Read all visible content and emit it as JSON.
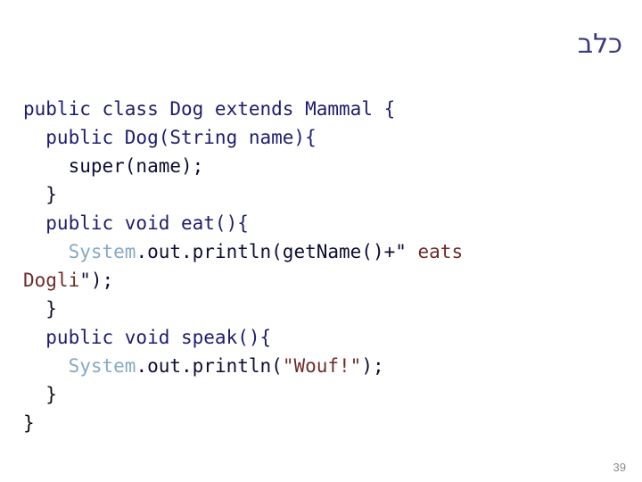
{
  "slide": {
    "title": "כלב",
    "title_color": "#3a3a80",
    "background_color": "#ffffff",
    "page_number": "39"
  },
  "colors": {
    "code_default": "#1c1c6e",
    "code_dark": "#0d0d33",
    "code_black": "#101010",
    "class_name": "#86a9c4",
    "string_literal": "#6d2b2b",
    "page_number": "#8a8a8a"
  },
  "code": {
    "language": "java",
    "full_text": "public class Dog extends Mammal {\n  public Dog(String name){\n    super(name);\n  }\n  public void eat(){\n    System.out.println(getName()+\" eats Dogli\");\n  }\n  public void speak(){\n    System.out.println(\"Wouf!\");\n  }\n}",
    "lines": [
      {
        "id": "line-1",
        "segments": [
          {
            "text": "public class Dog extends Mammal {",
            "style": "tok-default"
          }
        ]
      },
      {
        "id": "line-2",
        "segments": [
          {
            "text": "  public Dog(String name){",
            "style": "tok-default"
          }
        ]
      },
      {
        "id": "line-3",
        "segments": [
          {
            "text": "    super(name);",
            "style": "tok-dark"
          }
        ]
      },
      {
        "id": "line-4",
        "segments": [
          {
            "text": "  }",
            "style": "tok-dark"
          }
        ]
      },
      {
        "id": "line-5",
        "segments": [
          {
            "text": "  public void eat(){",
            "style": "tok-default"
          }
        ]
      },
      {
        "id": "line-6",
        "segments": [
          {
            "text": "    ",
            "style": "tok-default"
          },
          {
            "text": "System",
            "style": "tok-class"
          },
          {
            "text": ".out.println(getName()+\"",
            "style": "tok-dark"
          },
          {
            "text": " eats",
            "style": "tok-string"
          }
        ]
      },
      {
        "id": "line-7",
        "segments": [
          {
            "text": "Dogli",
            "style": "tok-string"
          },
          {
            "text": "\");",
            "style": "tok-dark"
          }
        ]
      },
      {
        "id": "line-8",
        "segments": [
          {
            "text": "  }",
            "style": "tok-dark"
          }
        ]
      },
      {
        "id": "line-9",
        "segments": [
          {
            "text": "  public void speak(){",
            "style": "tok-default"
          }
        ]
      },
      {
        "id": "line-10",
        "segments": [
          {
            "text": "    ",
            "style": "tok-default"
          },
          {
            "text": "System",
            "style": "tok-class"
          },
          {
            "text": ".out.println(",
            "style": "tok-dark"
          },
          {
            "text": "\"Wouf!\"",
            "style": "tok-string"
          },
          {
            "text": ");",
            "style": "tok-dark"
          }
        ]
      },
      {
        "id": "line-11",
        "segments": [
          {
            "text": "  }",
            "style": "tok-black"
          }
        ]
      },
      {
        "id": "line-12",
        "segments": [
          {
            "text": "}",
            "style": "tok-black"
          }
        ]
      }
    ]
  }
}
